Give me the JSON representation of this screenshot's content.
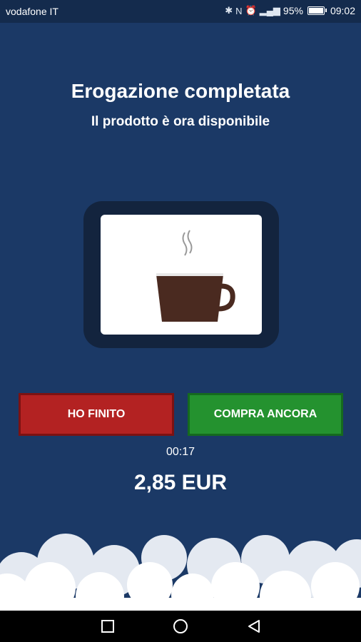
{
  "status_bar": {
    "carrier": "vodafone IT",
    "battery_percent": "95%",
    "time": "09:02",
    "icons": [
      "bluetooth-icon",
      "nfc-icon",
      "alarm-icon",
      "signal-icon",
      "battery-icon"
    ]
  },
  "header": {
    "title": "Erogazione completata",
    "subtitle": "Il prodotto è ora disponibile"
  },
  "product_display": {
    "icon": "coffee-cup-icon",
    "cup_color": "#4a2a20"
  },
  "actions": {
    "finish_label": "HO FINITO",
    "buy_again_label": "COMPRA ANCORA",
    "finish_color": "#b32222",
    "buy_again_color": "#24922f"
  },
  "timer": "00:17",
  "price": "2,85 EUR",
  "nav_bar": {
    "icons": [
      "recents-square-icon",
      "home-circle-icon",
      "back-triangle-icon"
    ]
  }
}
